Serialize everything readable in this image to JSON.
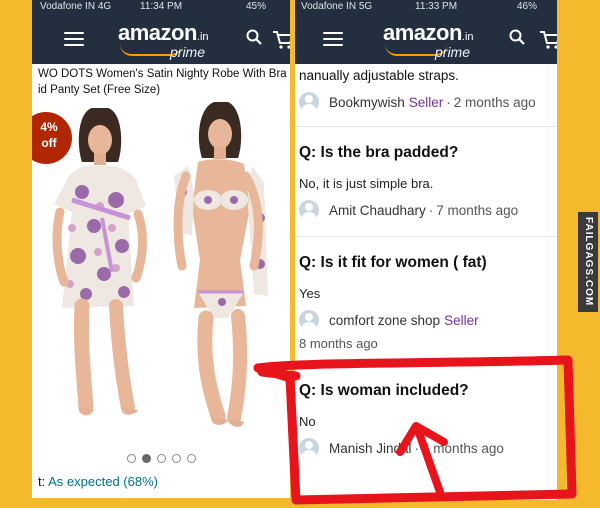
{
  "left": {
    "status": {
      "carrier": "Vodafone IN 4G",
      "time": "11:34 PM",
      "battery": "45%"
    },
    "header": {
      "logo_word": "amazon",
      "logo_tld": ".in",
      "logo_sub": "prime"
    },
    "product": {
      "title_line1": "WO DOTS Women's Satin Nighty Robe With Bra",
      "title_line2": "id Panty Set (Free Size)",
      "discount_line1": "4%",
      "discount_line2": "off",
      "rating_label": "t:",
      "rating_value": "As expected (68%)",
      "gallery_count": 5,
      "gallery_active": 2
    }
  },
  "right": {
    "status": {
      "carrier": "Vodafone IN 5G",
      "time": "11:33 PM",
      "battery": "46%"
    },
    "header": {
      "logo_word": "amazon",
      "logo_tld": ".in",
      "logo_sub": "prime"
    },
    "qa": {
      "prev_answer": "nanually adjustable straps.",
      "prev_author": "Bookmywish",
      "prev_badge": "Seller",
      "prev_time": "2 months ago",
      "items": [
        {
          "question": "Q: Is the bra padded?",
          "answer": "No, it is just simple bra.",
          "author": "Amit Chaudhary",
          "badge": "",
          "time": "7 months ago"
        },
        {
          "question": "Q: Is it fit for women ( fat)",
          "answer": "Yes",
          "author": "comfort zone shop",
          "badge": "Seller",
          "time": "8 months ago"
        },
        {
          "question": "Q: Is woman included?",
          "answer": "No",
          "author": "Manish Jindal",
          "badge": "",
          "time": "6 months ago"
        }
      ]
    }
  },
  "watermark": "FAILGAGS.COM",
  "colors": {
    "header_bg": "#232f3e",
    "background": "#f5b92e",
    "seller": "#7a2f9e",
    "highlight": "#e8141c",
    "link": "#007185"
  },
  "icons": {
    "menu": "hamburger-icon",
    "search": "search-icon",
    "cart": "cart-icon",
    "avatar": "user-avatar-icon"
  }
}
